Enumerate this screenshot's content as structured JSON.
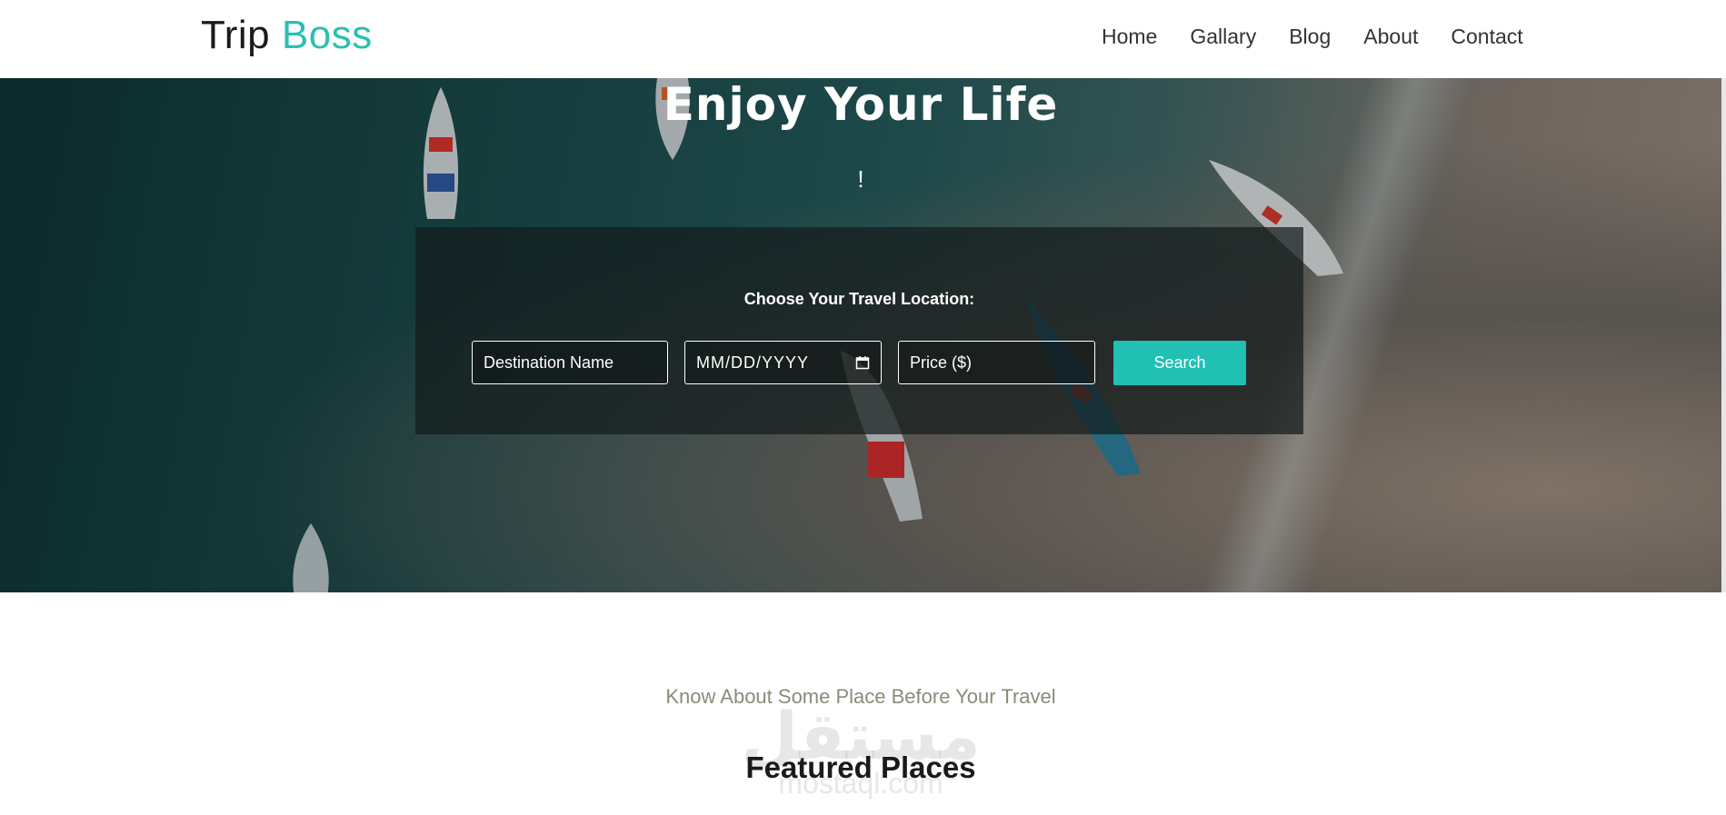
{
  "brand": {
    "part1": "Trip",
    "part2": "Boss"
  },
  "nav": {
    "items": [
      "Home",
      "Gallary",
      "Blog",
      "About",
      "Contact"
    ]
  },
  "hero": {
    "title": "Enjoy Your Life",
    "subtitle": "!"
  },
  "search": {
    "label": "Choose Your Travel Location:",
    "destination_placeholder": "Destination Name",
    "date_placeholder": "MM/DD/YYYY",
    "price_placeholder": "Price ($)",
    "button_label": "Search"
  },
  "featured": {
    "kicker": "Know About Some Place Before Your Travel",
    "title": "Featured Places"
  },
  "watermark": {
    "arabic": "مستقل",
    "latin": "mostaql.com"
  },
  "colors": {
    "accent": "#20c0b3",
    "logo_accent": "#2bbfb2",
    "text_dark": "#1b1b1b"
  },
  "icons": {
    "date": "calendar-icon"
  }
}
